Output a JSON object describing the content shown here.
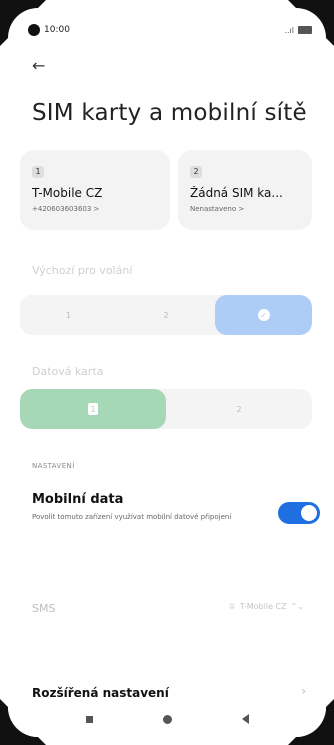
{
  "status": {
    "time": "10:00",
    "signal": "..ıl"
  },
  "header": {
    "back": "←",
    "title": "SIM karty a mobilní sítě"
  },
  "sim_cards": [
    {
      "slot": "1",
      "name": "T-Mobile CZ",
      "subtitle": "+420603603603 >"
    },
    {
      "slot": "2",
      "name": "Žádná SIM ka...",
      "subtitle": "Nenastaveno >"
    }
  ],
  "default_call": {
    "label": "Výchozí pro volání",
    "options": [
      "1",
      "2",
      "✓"
    ]
  },
  "data_card": {
    "label": "Datová karta",
    "options": [
      "1",
      "2"
    ]
  },
  "settings": {
    "section": "NASTAVENÍ",
    "mobile_data_title": "Mobilní data",
    "mobile_data_desc": "Povolit tomuto zařízení využívat mobilní datové připojení",
    "mobile_data_on": true
  },
  "sms": {
    "label": "SMS",
    "value": "T-Mobile CZ",
    "icon": "①",
    "chevron": "⌃⌄"
  },
  "advanced": {
    "label": "Rozšířená nastavení",
    "chevron": "›"
  },
  "colors": {
    "accent": "#1f6fe0",
    "call_selected": "#aecdf6",
    "data_selected": "#a6d8b7"
  }
}
